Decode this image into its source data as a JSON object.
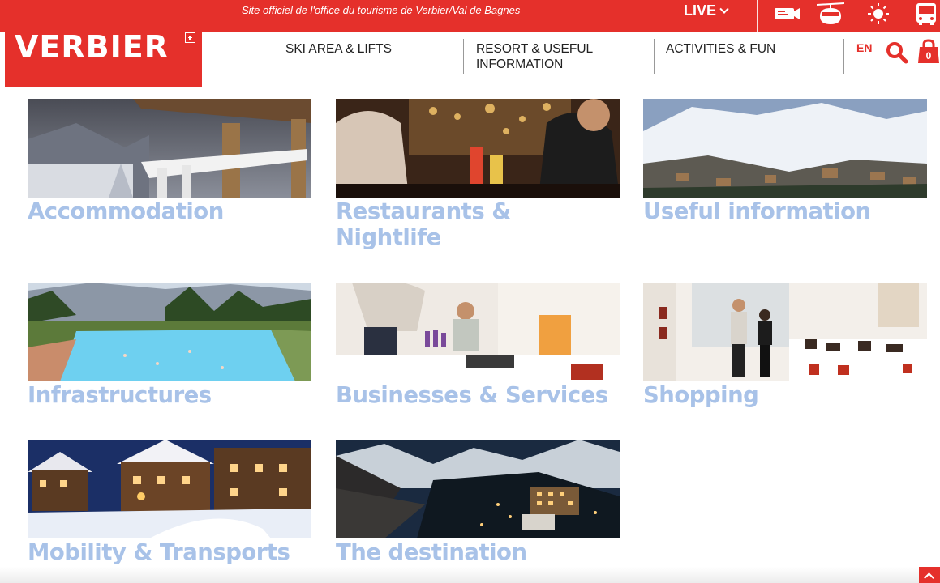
{
  "header": {
    "tagline": "Site officiel de l'office du tourisme de Verbier/Val de Bagnes",
    "live_label": "LIVE",
    "logo_text": "VERBIER",
    "brand_color": "#e5302b",
    "top_icons": [
      "webcam-icon",
      "gondola-icon",
      "weather-sun-icon",
      "bus-icon"
    ],
    "nav": [
      {
        "line1": "SKI AREA & LIFTS",
        "line2": ""
      },
      {
        "line1": "RESORT & USEFUL",
        "line2": "INFORMATION"
      },
      {
        "line1": "ACTIVITIES & FUN",
        "line2": ""
      }
    ],
    "language": "EN",
    "cart_count": "0"
  },
  "cards": [
    {
      "title": "Accommodation"
    },
    {
      "title": "Restaurants &",
      "title2": "Nightlife"
    },
    {
      "title": "Useful information"
    },
    {
      "title": "Infrastructures"
    },
    {
      "title": "Businesses & Services"
    },
    {
      "title": "Shopping"
    },
    {
      "title": "Mobility & Transports"
    },
    {
      "title": "The destination"
    }
  ],
  "title_color": "#a8c2e8"
}
